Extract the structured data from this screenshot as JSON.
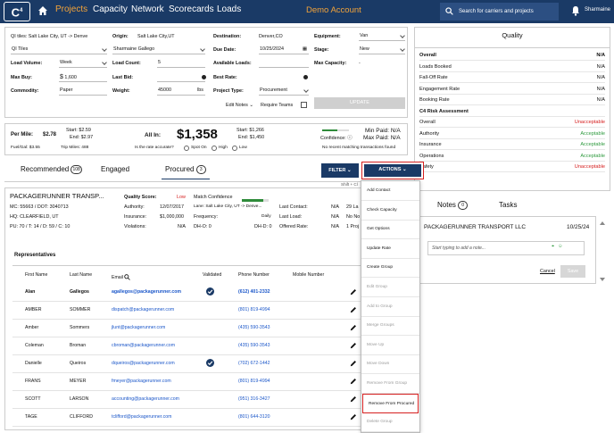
{
  "nav": {
    "logo": "C",
    "logo_sup": "4",
    "links": [
      "Projects",
      "Capacity",
      "Network",
      "Scorecards",
      "Loads"
    ],
    "demo": "Demo Account",
    "search": "Search for carriers and projects",
    "user": "Sharmaine"
  },
  "search": {
    "tag": "QI tiles: Salt Lake City, UT -> Denve",
    "qi_select": "QI Tiles",
    "origin_label": "Origin:",
    "origin": "Salt Lake City,UT",
    "destination_label": "Destination:",
    "destination": "Denver,CO",
    "equipment_label": "Equipment:",
    "equipment": "Van",
    "user_select": "Sharmaine Gallego",
    "due_label": "Due Date:",
    "due": "10/25/2024",
    "stage_label": "Stage:",
    "stage": "New",
    "load_volume_label": "Load Volume:",
    "load_volume": "Week",
    "load_count_label": "Load Count:",
    "load_count": "5",
    "avail_label": "Available Loads:",
    "maxcap_label": "Max Capacity:",
    "maxcap": "-",
    "maxbuy_label": "Max Buy:",
    "currency": "$",
    "maxbuy": "1,600",
    "lastbid_label": "Last Bid:",
    "bestrate_label": "Best Rate:",
    "commodity_label": "Commodity:",
    "commodity": "Paper",
    "weight_label": "Weight:",
    "weight": "45000",
    "weight_unit": "lbs",
    "projtype_label": "Project Type:",
    "projtype": "Procurement",
    "edit_notes": "Edit Notes",
    "require_teams": "Require Teams",
    "update": "UPDATE"
  },
  "rate": {
    "per_mile_label": "Per Mile:",
    "per_mile": "$2.78",
    "start1": "Start: $2.59",
    "end1": "End: $2.97",
    "fuel": "Fuel/Gal: $3.55",
    "trip": "Trip Miles: 488",
    "allin_label": "All In:",
    "allin": "$1,358",
    "start2": "Start: $1,266",
    "end2": "End: $1,450",
    "accurate": "Is the rate accurate?",
    "spot_on": "Spot On",
    "high": "High",
    "low": "Low",
    "confidence": "Confidence:",
    "confidence_level": 0.55,
    "min_paid": "Min Paid: N/A",
    "max_paid": "Max Paid: N/A",
    "no_recent": "No recent matching transactions found"
  },
  "quality": {
    "title": "Quality",
    "rows": [
      {
        "label": "Overall",
        "value": "N/A",
        "bold": true
      },
      {
        "label": "Loads Booked",
        "value": "N/A"
      },
      {
        "label": "Fall-Off Rate",
        "value": "N/A"
      },
      {
        "label": "Engagement Rate",
        "value": "N/A"
      },
      {
        "label": "Booking Rate",
        "value": "N/A"
      },
      {
        "label": "C4 Risk Assessment",
        "value": "",
        "bold": true
      },
      {
        "label": "Overall",
        "value": "Unacceptable",
        "color": "#d62020"
      },
      {
        "label": "Authority",
        "value": "Acceptable",
        "color": "#2e9a3e"
      },
      {
        "label": "Insurance",
        "value": "Acceptable",
        "color": "#2e9a3e"
      },
      {
        "label": "Operations",
        "value": "Acceptable",
        "color": "#2e9a3e"
      },
      {
        "label": "Safety",
        "value": "Unacceptable",
        "color": "#d62020"
      }
    ]
  },
  "tabs": {
    "recommended": "Recommended",
    "recommended_count": "108",
    "engaged": "Engaged",
    "procured": "Procured",
    "procured_count": "3",
    "filter": "FILTER",
    "actions": "ACTIONS",
    "shift_hint": "Shift + Cl"
  },
  "carrier": {
    "name": "PACKAGERUNNER TRANSP...",
    "mc": "MC: 55663 / DOT: 3040713",
    "hq": "HQ: CLEARFIELD, UT",
    "pu": "PU: 70 / T: 14 / D: 59 / C: 10",
    "quality_label": "Quality Score:",
    "quality": "Low",
    "authority_label": "Authority:",
    "authority": "12/07/2017",
    "insurance_label": "Insurance:",
    "insurance": "$1,000,000",
    "violations_label": "Violations:",
    "violations": "N/A",
    "match_label": "Match Confidence",
    "match_level": 0.8,
    "lane": "Lane: Salt Lake City, UT -> Denve...",
    "frequency_label": "Frequency:",
    "frequency": "Daily",
    "dho_label": "DH-O: 0",
    "dhd_label": "DH-D: 0",
    "last_contact_label": "Last Contact:",
    "last_contact": "N/A",
    "last_load_label": "Last Load:",
    "last_load": "N/A",
    "offered_label": "Offered Rate:",
    "offered": "N/A",
    "extra1": "29 La",
    "extra2": "No No",
    "extra3": "1 Proj",
    "reps_title": "Representatives",
    "headers": [
      "First Name",
      "Last Name",
      "Email",
      "Validated",
      "Phone Number",
      "Mobile Number"
    ],
    "reps": [
      {
        "first": "Alan",
        "last": "Gallegos",
        "email": "agallegos@packagerunner.com",
        "validated": true,
        "phone": "(612) 401-2332",
        "bold": true
      },
      {
        "first": "AMBER",
        "last": "SOMMER",
        "email": "dispatch@packagerunner.com",
        "validated": false,
        "phone": "(801) 819-4994"
      },
      {
        "first": "Amber",
        "last": "Sommers",
        "email": "jlunt@packagerunner.com",
        "validated": false,
        "phone": "(435) 590-3543"
      },
      {
        "first": "Coleman",
        "last": "Broman",
        "email": "cbroman@packagerunner.com",
        "validated": false,
        "phone": "(435) 590-3543"
      },
      {
        "first": "Danielle",
        "last": "Queiros",
        "email": "dqueiros@packagerunner.com",
        "validated": true,
        "phone": "(702) 672-1442"
      },
      {
        "first": "FRANS",
        "last": "MEYER",
        "email": "fmeyer@packagerunner.com",
        "validated": false,
        "phone": "(801) 819-4994"
      },
      {
        "first": "SCOTT",
        "last": "LARSON",
        "email": "accounting@packagerunner.com",
        "validated": false,
        "phone": "(951) 316-3427"
      },
      {
        "first": "TAGE",
        "last": "CLIFFORD",
        "email": "tclifford@packagerunner.com",
        "validated": false,
        "phone": "(801) 644-3120"
      }
    ]
  },
  "notes": {
    "notes_tab": "Notes",
    "notes_count": "0",
    "tasks_tab": "Tasks",
    "carrier": "PACKAGERUNNER TRANSPORT LLC",
    "date": "10/25/24",
    "placeholder": "Start typing to add a note...",
    "cancel": "Cancel",
    "save": "Save"
  },
  "actions_menu": [
    {
      "label": "Add Contact",
      "disabled": false
    },
    {
      "label": "Check Capacity",
      "disabled": false
    },
    {
      "label": "Get Options",
      "disabled": false
    },
    {
      "label": "Update Rate",
      "disabled": false
    },
    {
      "label": "Create Group",
      "disabled": false
    },
    {
      "label": "Edit Group",
      "disabled": true
    },
    {
      "label": "Add to Group",
      "disabled": true
    },
    {
      "label": "Merge Groups",
      "disabled": true
    },
    {
      "label": "Move Up",
      "disabled": true
    },
    {
      "label": "Move Down",
      "disabled": true
    },
    {
      "label": "Remove From Group",
      "disabled": true
    },
    {
      "label": "Remove From Procured",
      "disabled": false,
      "highlight": true
    },
    {
      "label": "Delete Group",
      "disabled": true
    }
  ]
}
